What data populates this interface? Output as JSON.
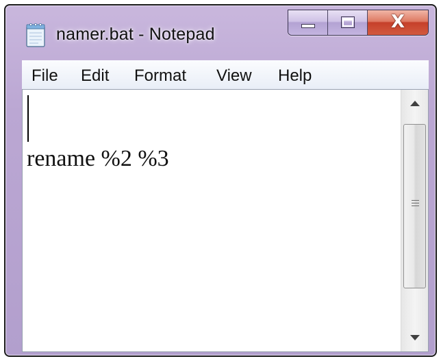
{
  "window": {
    "title": "namer.bat - Notepad",
    "app_icon": "notepad-icon"
  },
  "caption_buttons": {
    "minimize_icon": "minimize-icon",
    "maximize_icon": "maximize-icon",
    "close_glyph": "X"
  },
  "menubar": {
    "items": [
      {
        "label": "File"
      },
      {
        "label": "Edit"
      },
      {
        "label": "Format"
      },
      {
        "label": "View"
      },
      {
        "label": "Help"
      }
    ]
  },
  "editor": {
    "lines": [
      "",
      "rename %2 %3"
    ]
  },
  "scrollbar": {
    "up_icon": "scroll-up-arrow-icon",
    "down_icon": "scroll-down-arrow-icon"
  },
  "colors": {
    "frame": "#bba7d3",
    "close_button": "#c6402a",
    "menubar": "#eef2f8",
    "editor_background": "#ffffff"
  }
}
